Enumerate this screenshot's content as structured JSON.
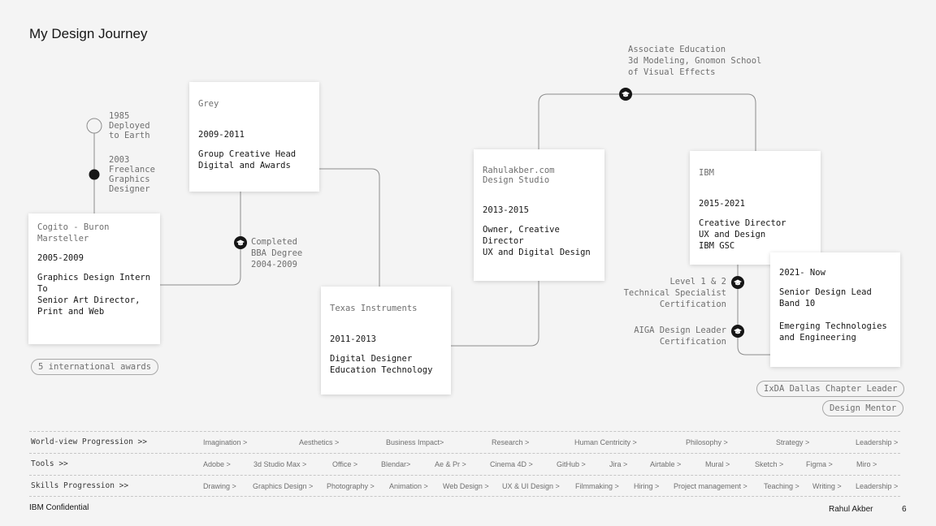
{
  "slide": {
    "title": "My Design Journey",
    "footer_left": "IBM Confidential",
    "footer_author": "Rahul Akber",
    "page_number": "6"
  },
  "early": {
    "milestone_1985": "1985\nDeployed\nto Earth",
    "milestone_2003": "2003\nFreelance\nGraphics\nDesigner"
  },
  "cards": {
    "cogito": {
      "company": "Cogito - Buron\nMarsteller",
      "years": "2005-2009",
      "role": "Graphics Design Intern\nTo\nSenior Art Director,\nPrint and Web"
    },
    "grey": {
      "company": "Grey",
      "years": "2009-2011",
      "role": "Group Creative Head\nDigital and Awards"
    },
    "texas": {
      "company": "Texas Instruments",
      "years": "2011-2013",
      "role": "Digital Designer\nEducation Technology"
    },
    "rahulakber": {
      "company": "Rahulakber.com\nDesign Studio",
      "years": "2013-2015",
      "role": "Owner, Creative\nDirector\nUX and Digital Design"
    },
    "ibm": {
      "company": "IBM",
      "years": "2015-2021",
      "role": "Creative Director\nUX and Design\nIBM GSC"
    },
    "now": {
      "years": "2021- Now",
      "role": "Senior Design Lead\nBand 10",
      "role2": "Emerging Technologies\nand Engineering"
    }
  },
  "education": {
    "bba": "Completed\nBBA Degree\n2004-2009",
    "associate": "Associate Education\n3d Modeling, Gnomon School\nof Visual Effects",
    "tech_spec": "Level 1 & 2\nTechnical Specialist\nCertification",
    "aiga": "AIGA Design Leader\nCertification"
  },
  "badges": {
    "awards": "5 international awards",
    "ixda": "IxDA Dallas Chapter Leader",
    "mentor": "Design Mentor"
  },
  "rows": [
    {
      "label": "World-view Progression >>",
      "items": [
        "Imagination  >",
        "Aesthetics >",
        "Business Impact>",
        "Research >",
        "Human Centricity >",
        "Philosophy >",
        "Strategy >",
        "Leadership >"
      ]
    },
    {
      "label": "Tools >>",
      "items": [
        "Adobe >",
        "3d Studio Max >",
        "Office >",
        "Blendar>",
        "Ae & Pr >",
        "Cinema 4D >",
        "GitHub >",
        "Jira >",
        "Airtable >",
        "Mural >",
        "Sketch >",
        "Figma >",
        "Miro >"
      ]
    },
    {
      "label": "Skills Progression >>",
      "items": [
        "Drawing  >",
        "Graphics Design >",
        "Photography >",
        "Animation >",
        "Web Design >",
        "UX & UI Design >",
        "Filmmaking >",
        "Hiring >",
        "Project management >",
        "Teaching >",
        "Writing >",
        "Leadership >"
      ]
    }
  ],
  "colors": {
    "background": "#f4f4f4",
    "line": "#8d8d8d",
    "text": "#161616",
    "muted": "#6f6f6f"
  }
}
